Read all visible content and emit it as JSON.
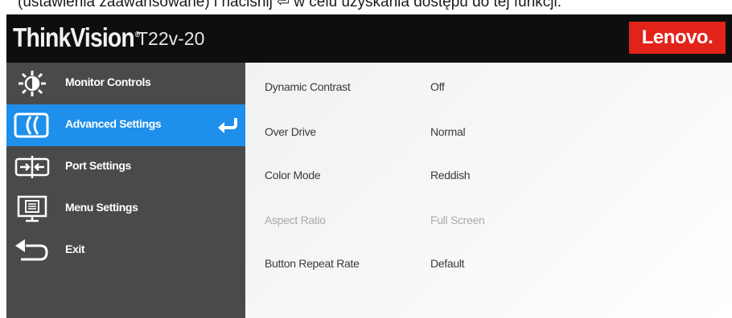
{
  "page_caption": "(ustawienia zaawansowane) i naciśnij  ⏎  w celu uzyskania dostępu do tej funkcji.",
  "header": {
    "brand": "ThinkVision",
    "brand_mark": "®",
    "model": "T22v-20",
    "vendor_logo": "Lenovo.",
    "logo_color": "#e2231a"
  },
  "sidebar": {
    "active_color": "#1e8fea",
    "items": [
      {
        "label": "Monitor Controls",
        "icon": "brightness-icon"
      },
      {
        "label": "Advanced Settings",
        "icon": "advanced-settings-icon",
        "active": true,
        "enter_icon": "enter-icon"
      },
      {
        "label": "Port Settings",
        "icon": "port-settings-icon"
      },
      {
        "label": "Menu Settings",
        "icon": "menu-settings-icon"
      },
      {
        "label": "Exit",
        "icon": "exit-arrow-icon"
      }
    ]
  },
  "settings": [
    {
      "name": "Dynamic Contrast",
      "value": "Off"
    },
    {
      "name": "Over Drive",
      "value": "Normal"
    },
    {
      "name": "Color Mode",
      "value": "Reddish"
    },
    {
      "name": "Aspect Ratio",
      "value": "Full Screen",
      "disabled": true
    },
    {
      "name": "Button Repeat Rate",
      "value": "Default"
    }
  ]
}
